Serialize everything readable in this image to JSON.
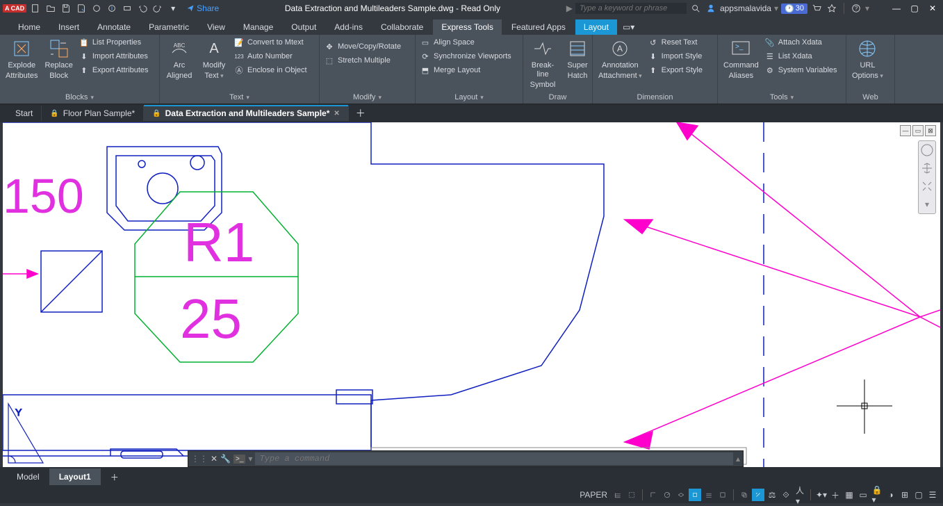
{
  "titlebar": {
    "logo": "A CAD",
    "share": "Share",
    "title": "Data Extraction and Multileaders Sample.dwg - Read Only",
    "search_placeholder": "Type a keyword or phrase",
    "user": "appsmalavida",
    "trial": "30"
  },
  "menutabs": [
    "Home",
    "Insert",
    "Annotate",
    "Parametric",
    "View",
    "Manage",
    "Output",
    "Add-ins",
    "Collaborate",
    "Express Tools",
    "Featured Apps",
    "Layout"
  ],
  "menutabs_active_express": 9,
  "menutabs_active_layout": 11,
  "ribbon": {
    "panels": [
      {
        "label": "Blocks",
        "big": [
          {
            "label1": "Explode",
            "label2": "Attributes"
          },
          {
            "label1": "Replace",
            "label2": "Block"
          }
        ],
        "rows": [
          "List Properties",
          "Import Attributes",
          "Export Attributes"
        ]
      },
      {
        "label": "Text",
        "big": [
          {
            "label1": "Arc",
            "label2": "Aligned"
          },
          {
            "label1": "Modify",
            "label2": "Text"
          }
        ],
        "rows": [
          "Convert to Mtext",
          "Auto Number",
          "Enclose in Object"
        ]
      },
      {
        "label": "Modify",
        "rows": [
          "Move/Copy/Rotate",
          "Stretch Multiple"
        ]
      },
      {
        "label": "Layout",
        "rows": [
          "Align Space",
          "Synchronize Viewports",
          "Merge Layout"
        ]
      },
      {
        "label": "Draw",
        "big": [
          {
            "label1": "Break-line",
            "label2": "Symbol"
          },
          {
            "label1": "Super",
            "label2": "Hatch"
          }
        ]
      },
      {
        "label": "Dimension",
        "big": [
          {
            "label1": "Annotation",
            "label2": "Attachment"
          }
        ],
        "rows": [
          "Reset Text",
          "Import Style",
          "Export Style"
        ]
      },
      {
        "label": "Tools",
        "big": [
          {
            "label1": "Command",
            "label2": "Aliases"
          }
        ],
        "rows": [
          "Attach Xdata",
          "List Xdata",
          "System Variables"
        ]
      },
      {
        "label": "Web",
        "big": [
          {
            "label1": "URL",
            "label2": "Options"
          }
        ]
      }
    ]
  },
  "filetabs": {
    "start": "Start",
    "tab1": "Floor Plan Sample*",
    "tab2": "Data Extraction and Multileaders Sample*"
  },
  "drawing": {
    "text_150": "150",
    "text_R1": "R1",
    "text_25": "25"
  },
  "cmdline": {
    "placeholder": "Type a command"
  },
  "layouttabs": {
    "model": "Model",
    "layout1": "Layout1"
  },
  "statusbar": {
    "paper": "PAPER"
  }
}
